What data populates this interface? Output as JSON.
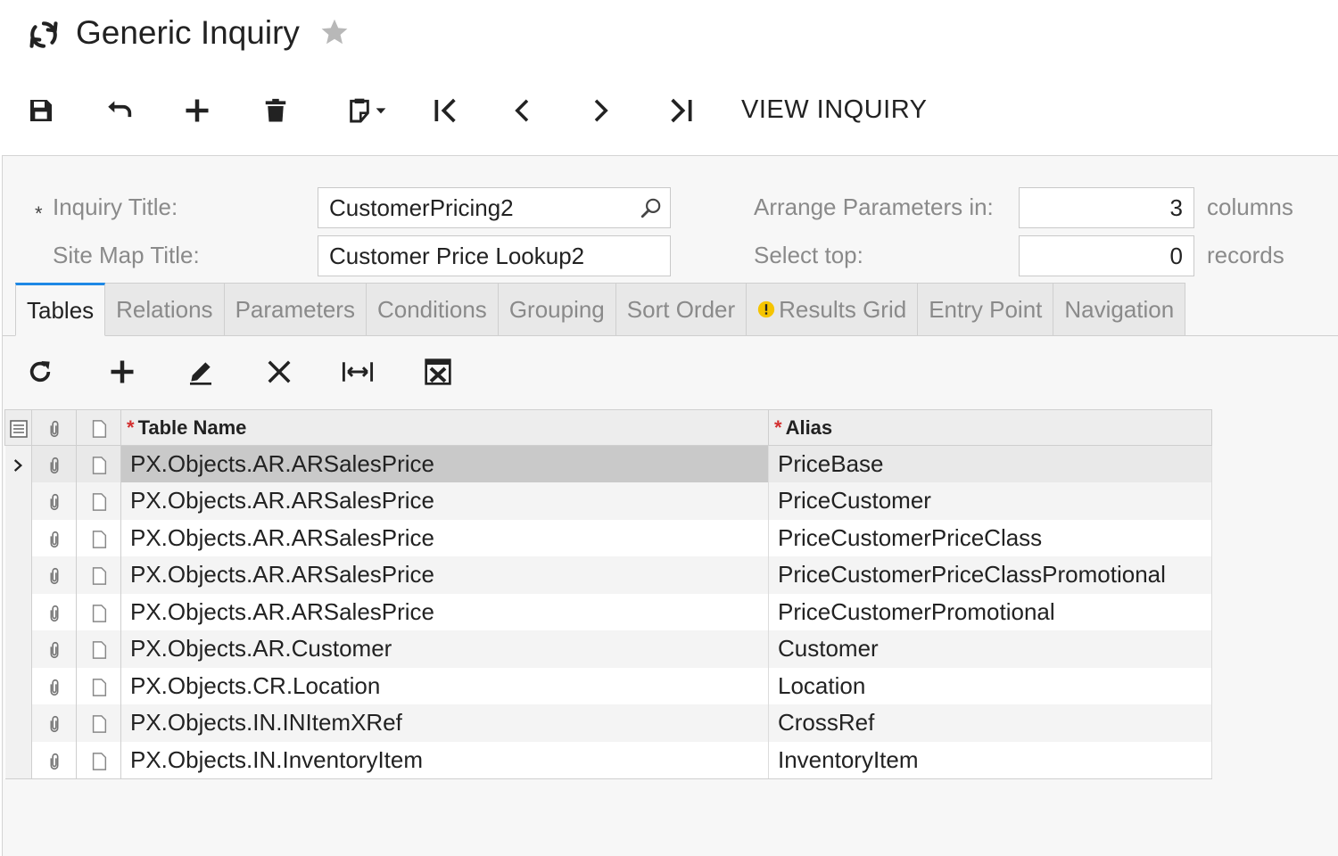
{
  "header": {
    "title": "Generic Inquiry",
    "refresh_icon": "refresh-icon",
    "favorite_icon": "star-icon"
  },
  "toolbar": {
    "buttons": [
      "save-icon",
      "undo-icon",
      "add-icon",
      "delete-icon",
      "clipboard-icon",
      "first-record-icon",
      "previous-record-icon",
      "next-record-icon",
      "last-record-icon"
    ],
    "view_inquiry_label": "VIEW INQUIRY"
  },
  "form": {
    "required_mark": "*",
    "inquiry_title_label": "Inquiry Title:",
    "inquiry_title_value": "CustomerPricing2",
    "site_map_title_label": "Site Map Title:",
    "site_map_title_value": "Customer Price Lookup2",
    "arrange_params_label": "Arrange Parameters in:",
    "arrange_params_value": "3",
    "arrange_params_unit": "columns",
    "select_top_label": "Select top:",
    "select_top_value": "0",
    "select_top_unit": "records"
  },
  "tabs": [
    {
      "label": "Tables",
      "active": true
    },
    {
      "label": "Relations"
    },
    {
      "label": "Parameters"
    },
    {
      "label": "Conditions"
    },
    {
      "label": "Grouping"
    },
    {
      "label": "Sort Order"
    },
    {
      "label": "Results Grid",
      "warning": true
    },
    {
      "label": "Entry Point"
    },
    {
      "label": "Navigation"
    }
  ],
  "grid_toolbar": {
    "buttons": [
      "refresh-icon",
      "add-row-icon",
      "edit-icon",
      "delete-row-icon",
      "fit-columns-icon",
      "export-excel-icon"
    ]
  },
  "grid": {
    "columns": {
      "table_name": "Table Name",
      "alias": "Alias",
      "required_mark": "*"
    },
    "rows": [
      {
        "table_name": "PX.Objects.AR.ARSalesPrice",
        "alias": "PriceBase",
        "selected": true
      },
      {
        "table_name": "PX.Objects.AR.ARSalesPrice",
        "alias": "PriceCustomer"
      },
      {
        "table_name": "PX.Objects.AR.ARSalesPrice",
        "alias": "PriceCustomerPriceClass"
      },
      {
        "table_name": "PX.Objects.AR.ARSalesPrice",
        "alias": "PriceCustomerPriceClassPromotional"
      },
      {
        "table_name": "PX.Objects.AR.ARSalesPrice",
        "alias": "PriceCustomerPromotional"
      },
      {
        "table_name": "PX.Objects.AR.Customer",
        "alias": "Customer"
      },
      {
        "table_name": "PX.Objects.CR.Location",
        "alias": "Location"
      },
      {
        "table_name": "PX.Objects.IN.INItemXRef",
        "alias": "CrossRef"
      },
      {
        "table_name": "PX.Objects.IN.InventoryItem",
        "alias": "InventoryItem"
      }
    ]
  },
  "colors": {
    "accent": "#1e88e5",
    "required": "#d32f2f",
    "warning": "#f5c400"
  }
}
